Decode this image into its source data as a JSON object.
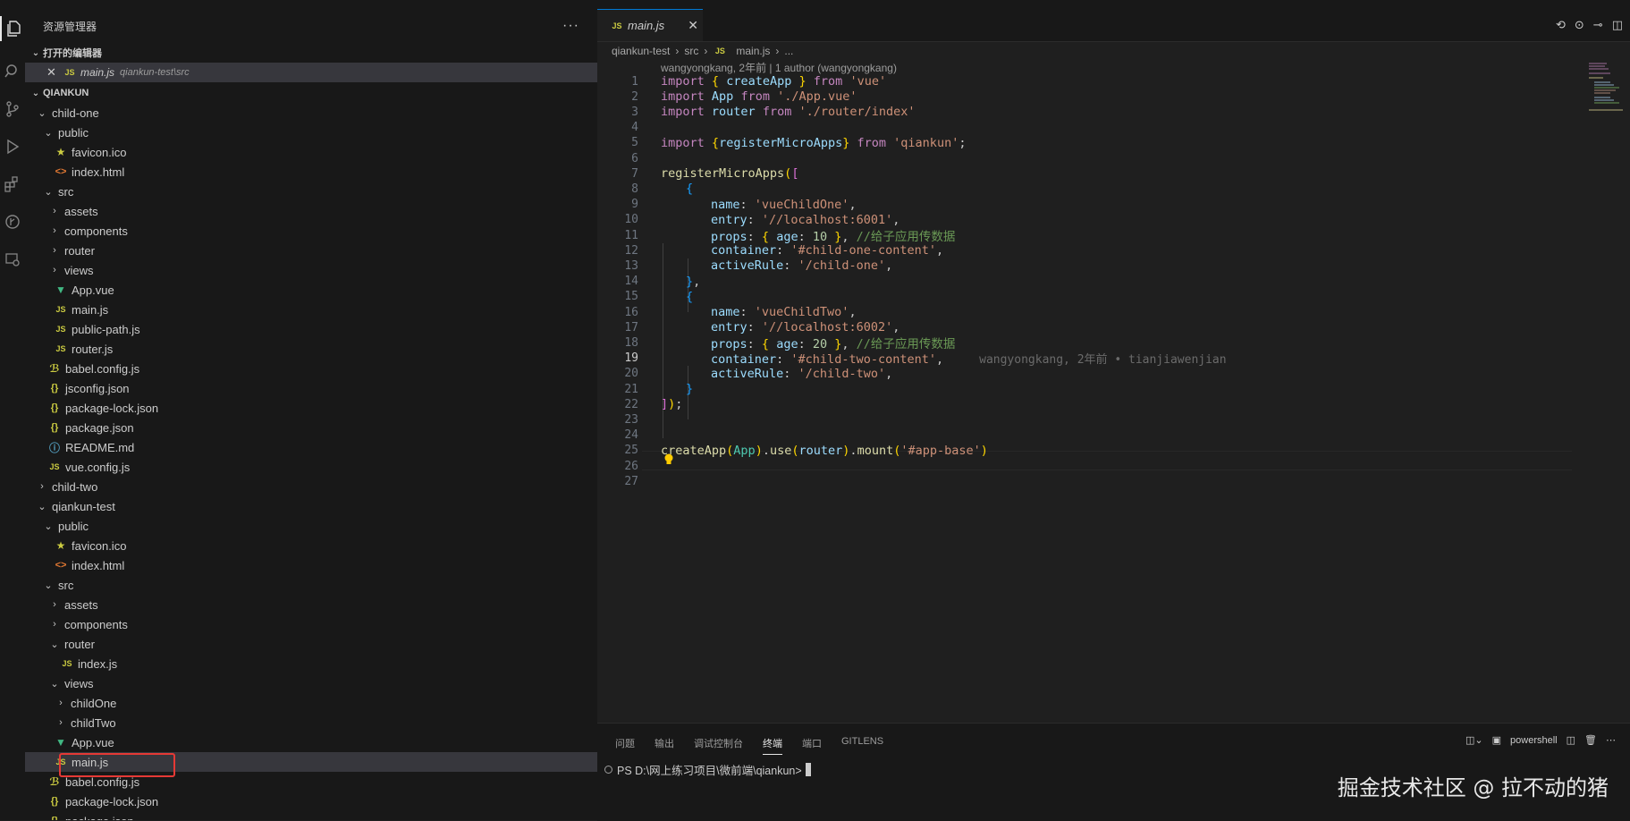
{
  "sidebar": {
    "title": "资源管理器",
    "more": "···",
    "open_editors_title": "打开的编辑器",
    "open_editor": {
      "file": "main.js",
      "path": "qiankun-test\\src"
    },
    "workspace_title": "QIANKUN",
    "tree": [
      {
        "label": "child-one",
        "indent": 0,
        "kind": "folder",
        "open": true
      },
      {
        "label": "public",
        "indent": 1,
        "kind": "folder",
        "open": true
      },
      {
        "label": "favicon.ico",
        "indent": 2,
        "kind": "star"
      },
      {
        "label": "index.html",
        "indent": 2,
        "kind": "html"
      },
      {
        "label": "src",
        "indent": 1,
        "kind": "folder",
        "open": true
      },
      {
        "label": "assets",
        "indent": 2,
        "kind": "folder",
        "open": false
      },
      {
        "label": "components",
        "indent": 2,
        "kind": "folder",
        "open": false
      },
      {
        "label": "router",
        "indent": 2,
        "kind": "folder",
        "open": false
      },
      {
        "label": "views",
        "indent": 2,
        "kind": "folder",
        "open": false
      },
      {
        "label": "App.vue",
        "indent": 2,
        "kind": "vue"
      },
      {
        "label": "main.js",
        "indent": 2,
        "kind": "js"
      },
      {
        "label": "public-path.js",
        "indent": 2,
        "kind": "js"
      },
      {
        "label": "router.js",
        "indent": 2,
        "kind": "js"
      },
      {
        "label": "babel.config.js",
        "indent": 1,
        "kind": "babel"
      },
      {
        "label": "jsconfig.json",
        "indent": 1,
        "kind": "json"
      },
      {
        "label": "package-lock.json",
        "indent": 1,
        "kind": "json"
      },
      {
        "label": "package.json",
        "indent": 1,
        "kind": "json"
      },
      {
        "label": "README.md",
        "indent": 1,
        "kind": "md"
      },
      {
        "label": "vue.config.js",
        "indent": 1,
        "kind": "js"
      },
      {
        "label": "child-two",
        "indent": 0,
        "kind": "folder",
        "open": false
      },
      {
        "label": "qiankun-test",
        "indent": 0,
        "kind": "folder",
        "open": true
      },
      {
        "label": "public",
        "indent": 1,
        "kind": "folder",
        "open": true
      },
      {
        "label": "favicon.ico",
        "indent": 2,
        "kind": "star"
      },
      {
        "label": "index.html",
        "indent": 2,
        "kind": "html"
      },
      {
        "label": "src",
        "indent": 1,
        "kind": "folder",
        "open": true
      },
      {
        "label": "assets",
        "indent": 2,
        "kind": "folder",
        "open": false
      },
      {
        "label": "components",
        "indent": 2,
        "kind": "folder",
        "open": false
      },
      {
        "label": "router",
        "indent": 2,
        "kind": "folder",
        "open": true
      },
      {
        "label": "index.js",
        "indent": 3,
        "kind": "js"
      },
      {
        "label": "views",
        "indent": 2,
        "kind": "folder",
        "open": true
      },
      {
        "label": "childOne",
        "indent": 3,
        "kind": "folder",
        "open": false
      },
      {
        "label": "childTwo",
        "indent": 3,
        "kind": "folder",
        "open": false
      },
      {
        "label": "App.vue",
        "indent": 2,
        "kind": "vue"
      },
      {
        "label": "main.js",
        "indent": 2,
        "kind": "js",
        "selected": true
      },
      {
        "label": "babel.config.js",
        "indent": 1,
        "kind": "babel"
      },
      {
        "label": "package-lock.json",
        "indent": 1,
        "kind": "json"
      },
      {
        "label": "package.json",
        "indent": 1,
        "kind": "json"
      }
    ]
  },
  "editor": {
    "tab_label": "main.js",
    "tab_close": "✕",
    "breadcrumb": [
      "qiankun-test",
      "src",
      "main.js",
      "..."
    ],
    "blame_header": "wangyongkang, 2年前 | 1 author (wangyongkang)",
    "current_line": 19,
    "inline_blame": "wangyongkang, 2年前 • tianjiawenjian",
    "line_numbers": [
      "1",
      "2",
      "3",
      "4",
      "5",
      "6",
      "7",
      "8",
      "9",
      "10",
      "11",
      "12",
      "13",
      "14",
      "15",
      "16",
      "17",
      "18",
      "19",
      "20",
      "21",
      "22",
      "23",
      "24",
      "25",
      "26",
      "27"
    ]
  },
  "code": {
    "l1": [
      "import",
      "{",
      "createApp",
      "}",
      "from",
      "'vue'"
    ],
    "l2": [
      "import",
      "App",
      "from",
      "'./App.vue'"
    ],
    "l3": [
      "import",
      "router",
      "from",
      "'./router/index'"
    ],
    "l5": [
      "import",
      "{",
      "registerMicroApps",
      "}",
      "from",
      "'qiankun'",
      ";"
    ],
    "l7": [
      "registerMicroApps",
      "(",
      "["
    ],
    "l8": [
      "{"
    ],
    "l9": [
      "name",
      ": ",
      "'vueChildOne'",
      ","
    ],
    "l10": [
      "entry",
      ": ",
      "'//localhost:6001'",
      ","
    ],
    "l11": [
      "props",
      ": ",
      "{",
      "age",
      ": ",
      "10",
      "}",
      ", ",
      "//给子应用传数据"
    ],
    "l12": [
      "container",
      ": ",
      "'#child-one-content'",
      ","
    ],
    "l13": [
      "activeRule",
      ": ",
      "'/child-one'",
      ","
    ],
    "l14": [
      "}",
      ","
    ],
    "l15": [
      "{"
    ],
    "l16": [
      "name",
      ": ",
      "'vueChildTwo'",
      ","
    ],
    "l17": [
      "entry",
      ": ",
      "'//localhost:6002'",
      ","
    ],
    "l18": [
      "props",
      ": ",
      "{",
      "age",
      ": ",
      "20",
      "}",
      ", ",
      "//给子应用传数据"
    ],
    "l19": [
      "container",
      ": ",
      "'#child-two-content'",
      ","
    ],
    "l20": [
      "activeRule",
      ": ",
      "'/child-two'",
      ","
    ],
    "l21": [
      "}"
    ],
    "l22": [
      "]",
      ")",
      ";"
    ],
    "l25": [
      "createApp",
      "(",
      "App",
      ")",
      ".",
      "use",
      "(",
      "router",
      ")",
      ".",
      "mount",
      "(",
      "'#app-base'",
      ")"
    ]
  },
  "panel": {
    "tabs": [
      "问题",
      "输出",
      "调试控制台",
      "终端",
      "端口",
      "GITLENS"
    ],
    "active_tab": "终端",
    "shell": "powershell",
    "prompt": "PS D:\\网上练习项目\\微前端\\qiankun>"
  },
  "watermark": "掘金技术社区 @ 拉不动的猪"
}
